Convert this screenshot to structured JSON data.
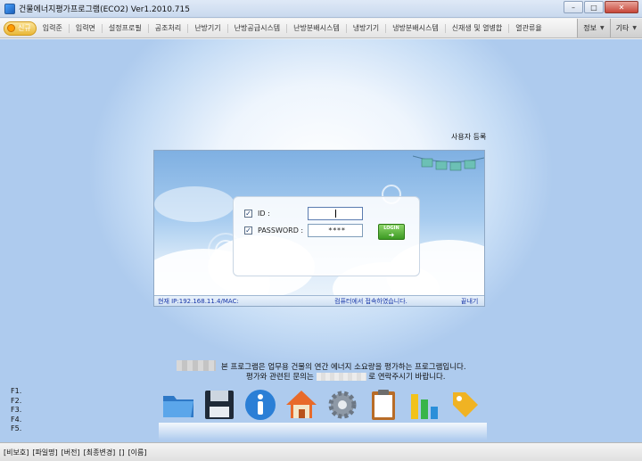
{
  "window": {
    "title": "건물에너지평가프로그램(ECO2) Ver1.2010.715",
    "controls": [
      "minimize",
      "maximize",
      "close"
    ]
  },
  "menu": {
    "first": "신규",
    "items": [
      "입력준",
      "입력면",
      "설정프로필",
      "공조처리",
      "난방기기",
      "난방공급시스템",
      "난방분배시스템",
      "냉방기기",
      "냉방분배시스템",
      "신재생 및 열병합",
      "열관류율"
    ],
    "right": [
      "정보",
      "기타"
    ]
  },
  "main": {
    "register_link": "사용자 등록",
    "login": {
      "id_label": "ID :",
      "password_label": "PASSWORD :",
      "password_value": "****",
      "login_button": "LOGIN",
      "id_checked": true,
      "password_checked": true
    },
    "status": {
      "ip": "현재 IP:192.168.11.4/MAC:",
      "message": "컴퓨터에서 접속하였습니다.",
      "close": "끝내기"
    },
    "description_line1": "본 프로그램은 업무용 건물의 연간 에너지 소요량을 평가하는 프로그램입니다.",
    "description_line2_a": "평가와 관련된 문의는",
    "description_line2_b": "로 연락주시기 바랍니다.",
    "fkeys": [
      "F1.",
      "F2.",
      "F3.",
      "F4.",
      "F5."
    ]
  },
  "dock": {
    "icons": [
      "folder-icon",
      "save-icon",
      "info-icon",
      "home-icon",
      "gear-icon",
      "clipboard-icon",
      "bar-chart-icon",
      "tag-icon"
    ]
  },
  "statusbar": {
    "items": [
      "[비보호]",
      "[파일명]",
      "[버전]",
      "[최종변경]",
      "[]",
      "[이름]"
    ]
  }
}
